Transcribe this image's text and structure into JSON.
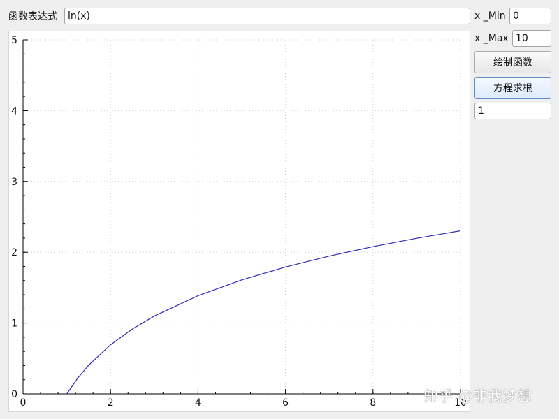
{
  "controls": {
    "expression_label": "函数表达式",
    "expression_value": "ln(x)",
    "x_min_label": "x _Min",
    "x_min_value": "0",
    "x_max_label": "x _Max",
    "x_max_value": "10",
    "plot_button_label": "绘制函数",
    "solve_button_label": "方程求根",
    "root_value": "1"
  },
  "chart_data": {
    "type": "line",
    "xlim": [
      0,
      10
    ],
    "ylim": [
      0,
      5
    ],
    "x_ticks": [
      0,
      2,
      4,
      6,
      8,
      10
    ],
    "y_ticks": [
      0,
      1,
      2,
      3,
      4,
      5
    ],
    "grid": true,
    "series": [
      {
        "color": "#2d2db5",
        "x": [
          1.0,
          1.25,
          1.5,
          2.0,
          2.5,
          3.0,
          4.0,
          5.0,
          6.0,
          7.0,
          8.0,
          9.0,
          10.0
        ],
        "y": [
          0.0,
          0.223,
          0.405,
          0.693,
          0.916,
          1.099,
          1.386,
          1.609,
          1.792,
          1.946,
          2.079,
          2.197,
          2.303
        ]
      }
    ]
  },
  "watermark": "知乎 @非我梦想"
}
